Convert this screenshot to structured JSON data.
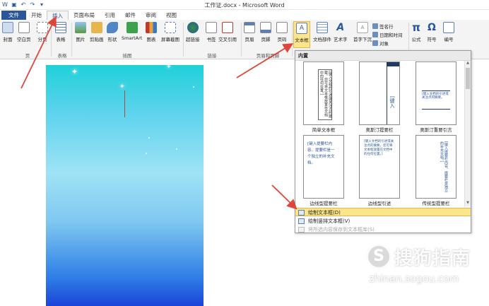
{
  "window": {
    "title": "工作证.docx - Microsoft Word"
  },
  "tabs": [
    "文件",
    "开始",
    "插入",
    "页面布局",
    "引用",
    "邮件",
    "审阅",
    "视图"
  ],
  "ribbon": {
    "buttons": {
      "cover": "封面",
      "blank": "空白页",
      "pagebreak": "分页",
      "table": "表格",
      "picture": "图片",
      "clipart": "剪贴画",
      "shapes": "形状",
      "smartart": "SmartArt",
      "chart": "图表",
      "screenshot": "屏幕截图",
      "hyperlink": "超链接",
      "bookmark": "书签",
      "crossref": "交叉引用",
      "header": "页眉",
      "footer": "页脚",
      "pagenum": "页码",
      "textbox": "文本框",
      "parts": "文档部件",
      "wordart": "艺术字",
      "dropcap": "首字下沉",
      "signature": "签名行",
      "datetime": "日期和时间",
      "object": "对象",
      "equation": "公式",
      "symbol": "符号",
      "number": "编号"
    },
    "groups": {
      "pages": "页",
      "tables": "表格",
      "illustrations": "插图",
      "links": "链接",
      "header_footer": "页眉和页脚"
    }
  },
  "dropdown": {
    "header": "内置",
    "items": [
      "简单文本框",
      "奥斯汀提要栏",
      "奥斯汀重要引言",
      "边线型提要栏",
      "边线型引述",
      "传统型提要栏"
    ],
    "thumb_text": {
      "simple": "[键入文档的引述或关注点的摘要。您可将文本框放置在文档中的任何位置。]",
      "austin_side": "[键入",
      "austin_quote": "[键入文档的引述或关注点的摘要。",
      "edge_side": "[键入提要栏内容。提要栏是一个独立的补充文档。",
      "edge_quote": "[键入文档的引述或关注点的摘要。您可将文本框放置在文档中的任何位置。]",
      "trad_side": "[键入提要栏内容。提要栏是独立的补充文档。]"
    },
    "menu": [
      "绘制文本框(D)",
      "绘制竖排文本框(V)",
      "将所选内容保存到文本框库(S)"
    ]
  },
  "watermark": {
    "brand": "搜狗指南",
    "url": "zhinan.sogou.com",
    "logo": "S"
  },
  "colors": {
    "file_tab": "#2b579a",
    "highlight": "#fde58b",
    "arrow": "#e0453a"
  }
}
